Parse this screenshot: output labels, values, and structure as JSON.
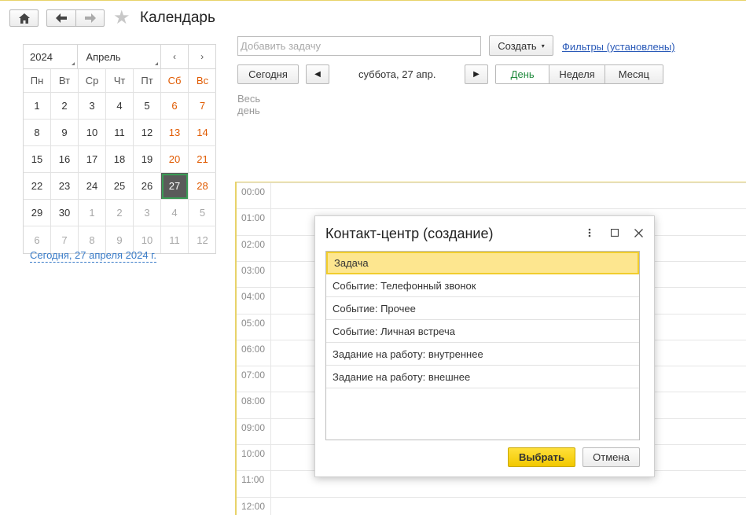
{
  "header": {
    "title": "Календарь"
  },
  "minical": {
    "year": "2024",
    "month": "Апрель",
    "dow": [
      {
        "label": "Пн",
        "we": false
      },
      {
        "label": "Вт",
        "we": false
      },
      {
        "label": "Ср",
        "we": false
      },
      {
        "label": "Чт",
        "we": false
      },
      {
        "label": "Пт",
        "we": false
      },
      {
        "label": "Сб",
        "we": true
      },
      {
        "label": "Вс",
        "we": true
      }
    ],
    "days": [
      {
        "d": "1"
      },
      {
        "d": "2"
      },
      {
        "d": "3"
      },
      {
        "d": "4"
      },
      {
        "d": "5"
      },
      {
        "d": "6",
        "we": true
      },
      {
        "d": "7",
        "we": true
      },
      {
        "d": "8"
      },
      {
        "d": "9"
      },
      {
        "d": "10"
      },
      {
        "d": "11"
      },
      {
        "d": "12"
      },
      {
        "d": "13",
        "we": true
      },
      {
        "d": "14",
        "we": true
      },
      {
        "d": "15"
      },
      {
        "d": "16"
      },
      {
        "d": "17"
      },
      {
        "d": "18"
      },
      {
        "d": "19"
      },
      {
        "d": "20",
        "we": true
      },
      {
        "d": "21",
        "we": true
      },
      {
        "d": "22"
      },
      {
        "d": "23"
      },
      {
        "d": "24"
      },
      {
        "d": "25"
      },
      {
        "d": "26"
      },
      {
        "d": "27",
        "sel": true
      },
      {
        "d": "28",
        "we": true
      },
      {
        "d": "29"
      },
      {
        "d": "30"
      },
      {
        "d": "1",
        "other": true
      },
      {
        "d": "2",
        "other": true
      },
      {
        "d": "3",
        "other": true
      },
      {
        "d": "4",
        "other": true
      },
      {
        "d": "5",
        "other": true
      },
      {
        "d": "6",
        "other": true
      },
      {
        "d": "7",
        "other": true
      },
      {
        "d": "8",
        "other": true
      },
      {
        "d": "9",
        "other": true
      },
      {
        "d": "10",
        "other": true
      },
      {
        "d": "11",
        "other": true
      },
      {
        "d": "12",
        "other": true
      }
    ],
    "today_link": "Сегодня, 27 апреля 2024 г."
  },
  "toolbar": {
    "add_task_placeholder": "Добавить задачу",
    "create_label": "Создать",
    "filters_label": "Фильтры (установлены)",
    "today_label": "Сегодня",
    "date_label": "суббота, 27 апр.",
    "views": [
      {
        "label": "День",
        "active": true
      },
      {
        "label": "Неделя",
        "active": false
      },
      {
        "label": "Месяц",
        "active": false
      }
    ]
  },
  "allday": {
    "line1": "Весь",
    "line2": "день"
  },
  "hours": [
    "00:00",
    "01:00",
    "02:00",
    "03:00",
    "04:00",
    "05:00",
    "06:00",
    "07:00",
    "08:00",
    "09:00",
    "10:00",
    "11:00",
    "12:00"
  ],
  "modal": {
    "title": "Контакт-центр (создание)",
    "items": [
      "Задача",
      "Событие: Телефонный звонок",
      "Событие: Прочее",
      "Событие: Личная встреча",
      "Задание на работу: внутреннее",
      "Задание на работу: внешнее"
    ],
    "selected_index": 0,
    "ok_label": "Выбрать",
    "cancel_label": "Отмена"
  },
  "colors": {
    "accent": "#1f8a3c",
    "weekend": "#e05a00",
    "highlight": "#fde68f",
    "primary_button": "#f2c800"
  }
}
